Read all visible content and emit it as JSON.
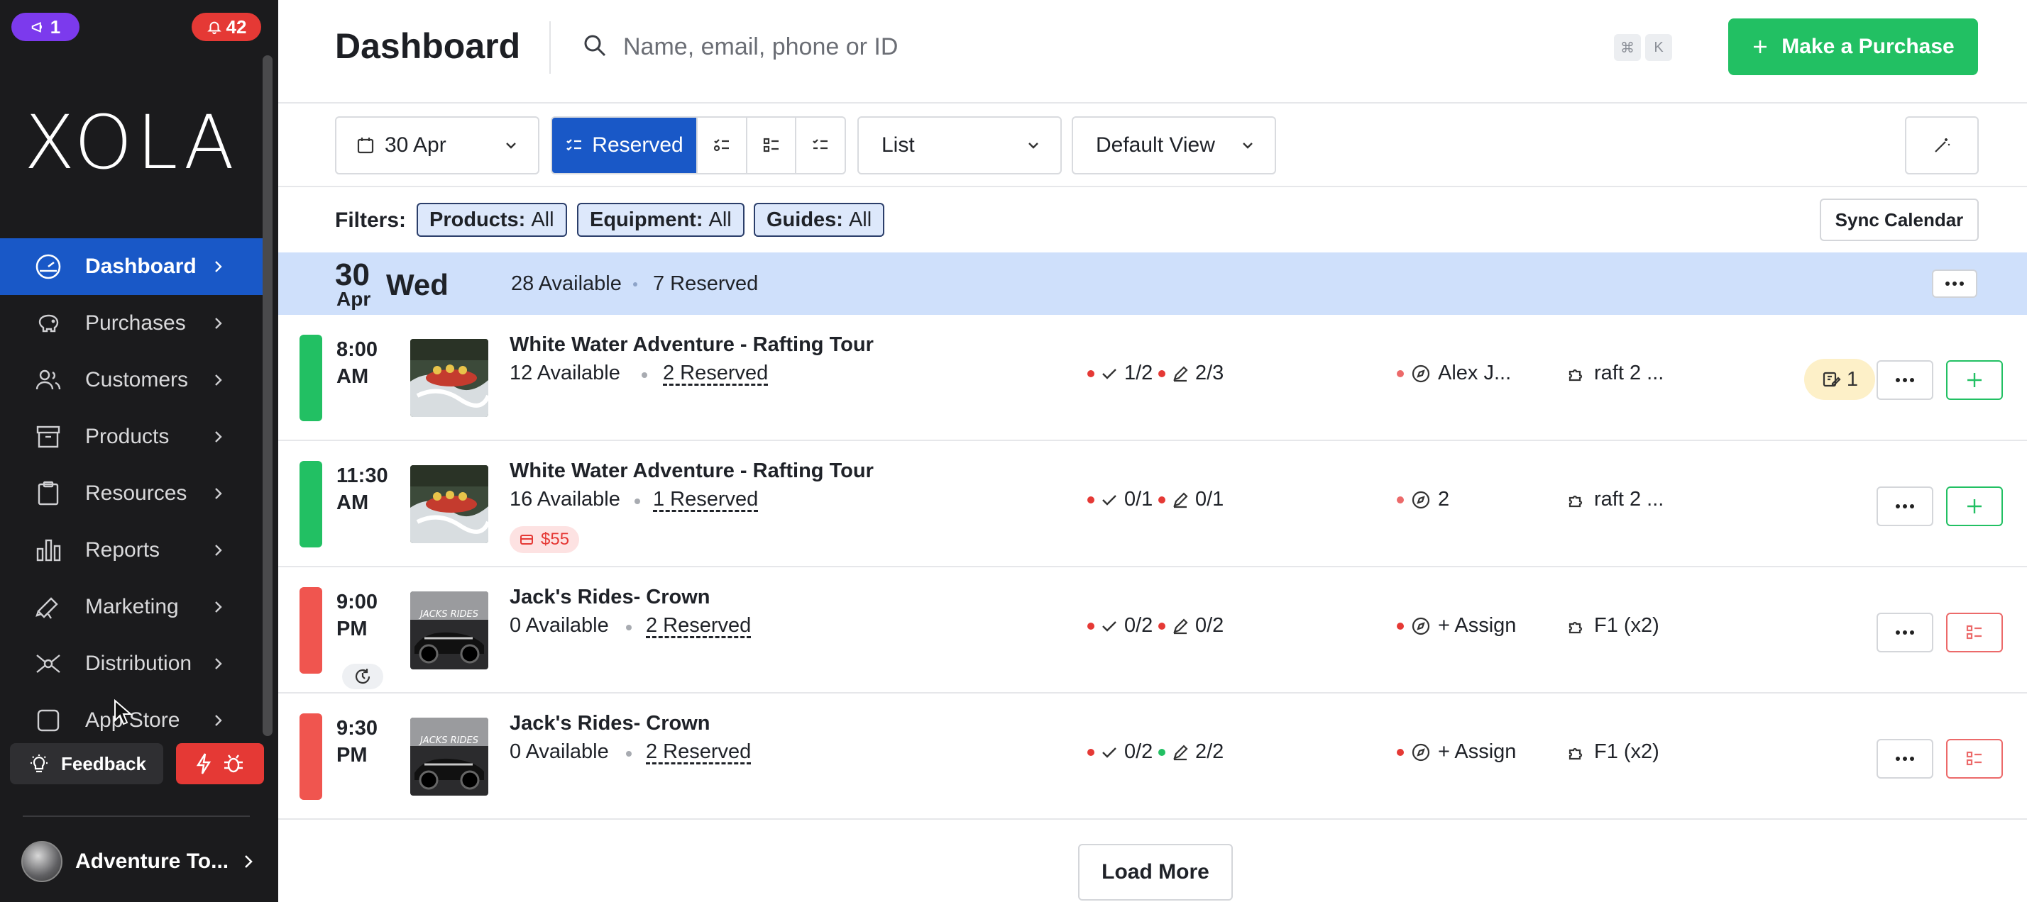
{
  "sidebar": {
    "top_badge_left": "1",
    "top_badge_right": "42",
    "logo": "XOLA",
    "items": [
      {
        "label": "Dashboard"
      },
      {
        "label": "Purchases"
      },
      {
        "label": "Customers"
      },
      {
        "label": "Products"
      },
      {
        "label": "Resources"
      },
      {
        "label": "Reports"
      },
      {
        "label": "Marketing"
      },
      {
        "label": "Distribution"
      },
      {
        "label": "App Store"
      }
    ],
    "feedback_label": "Feedback",
    "account_name": "Adventure To..."
  },
  "header": {
    "title": "Dashboard",
    "search_placeholder": "Name, email, phone or ID",
    "kbd_cmd": "⌘",
    "kbd_k": "K",
    "purchase_label": "Make a Purchase"
  },
  "toolbar": {
    "date": "30 Apr",
    "reserved_label": "Reserved",
    "list_label": "List",
    "view_label": "Default View"
  },
  "filters": {
    "label": "Filters:",
    "chips": [
      {
        "name": "Products:",
        "value": "All"
      },
      {
        "name": "Equipment:",
        "value": "All"
      },
      {
        "name": "Guides:",
        "value": "All"
      }
    ],
    "sync_label": "Sync Calendar"
  },
  "day": {
    "num": "30",
    "month": "Apr",
    "weekday": "Wed",
    "available": "28 Available",
    "reserved": "7 Reserved"
  },
  "rows": [
    {
      "time_h": "8:00",
      "time_ampm": "AM",
      "status_color": "#22c063",
      "title": "White Water Adventure - Rafting Tour",
      "available": "12 Available",
      "reserved": "2 Reserved",
      "checkin": "1/2",
      "checkin_dot": "#e53935",
      "waiver": "2/3",
      "waiver_dot": "#e53935",
      "guide": "Alex J...",
      "guide_dot": "#ec6a6a",
      "equipment": "raft 2 ...",
      "note_count": "1"
    },
    {
      "time_h": "11:30",
      "time_ampm": "AM",
      "status_color": "#22c063",
      "title": "White Water Adventure - Rafting Tour",
      "available": "16 Available",
      "reserved": "1 Reserved",
      "price": "$55",
      "checkin": "0/1",
      "checkin_dot": "#e53935",
      "waiver": "0/1",
      "waiver_dot": "#e53935",
      "guide": "2",
      "guide_dot": "#ec6a6a",
      "equipment": "raft 2 ..."
    },
    {
      "time_h": "9:00",
      "time_ampm": "PM",
      "status_color": "#f0554f",
      "title": "Jack's Rides- Crown",
      "available": "0 Available",
      "reserved": "2 Reserved",
      "checkin": "0/2",
      "checkin_dot": "#e53935",
      "waiver": "0/2",
      "waiver_dot": "#e53935",
      "guide": "+ Assign",
      "guide_dot": "#e53935",
      "equipment": "F1 (x2)"
    },
    {
      "time_h": "9:30",
      "time_ampm": "PM",
      "status_color": "#f0554f",
      "title": "Jack's Rides- Crown",
      "available": "0 Available",
      "reserved": "2 Reserved",
      "checkin": "0/2",
      "checkin_dot": "#e53935",
      "waiver": "2/2",
      "waiver_dot": "#22c063",
      "guide": "+ Assign",
      "guide_dot": "#e53935",
      "equipment": "F1 (x2)"
    }
  ],
  "load_more_label": "Load More"
}
